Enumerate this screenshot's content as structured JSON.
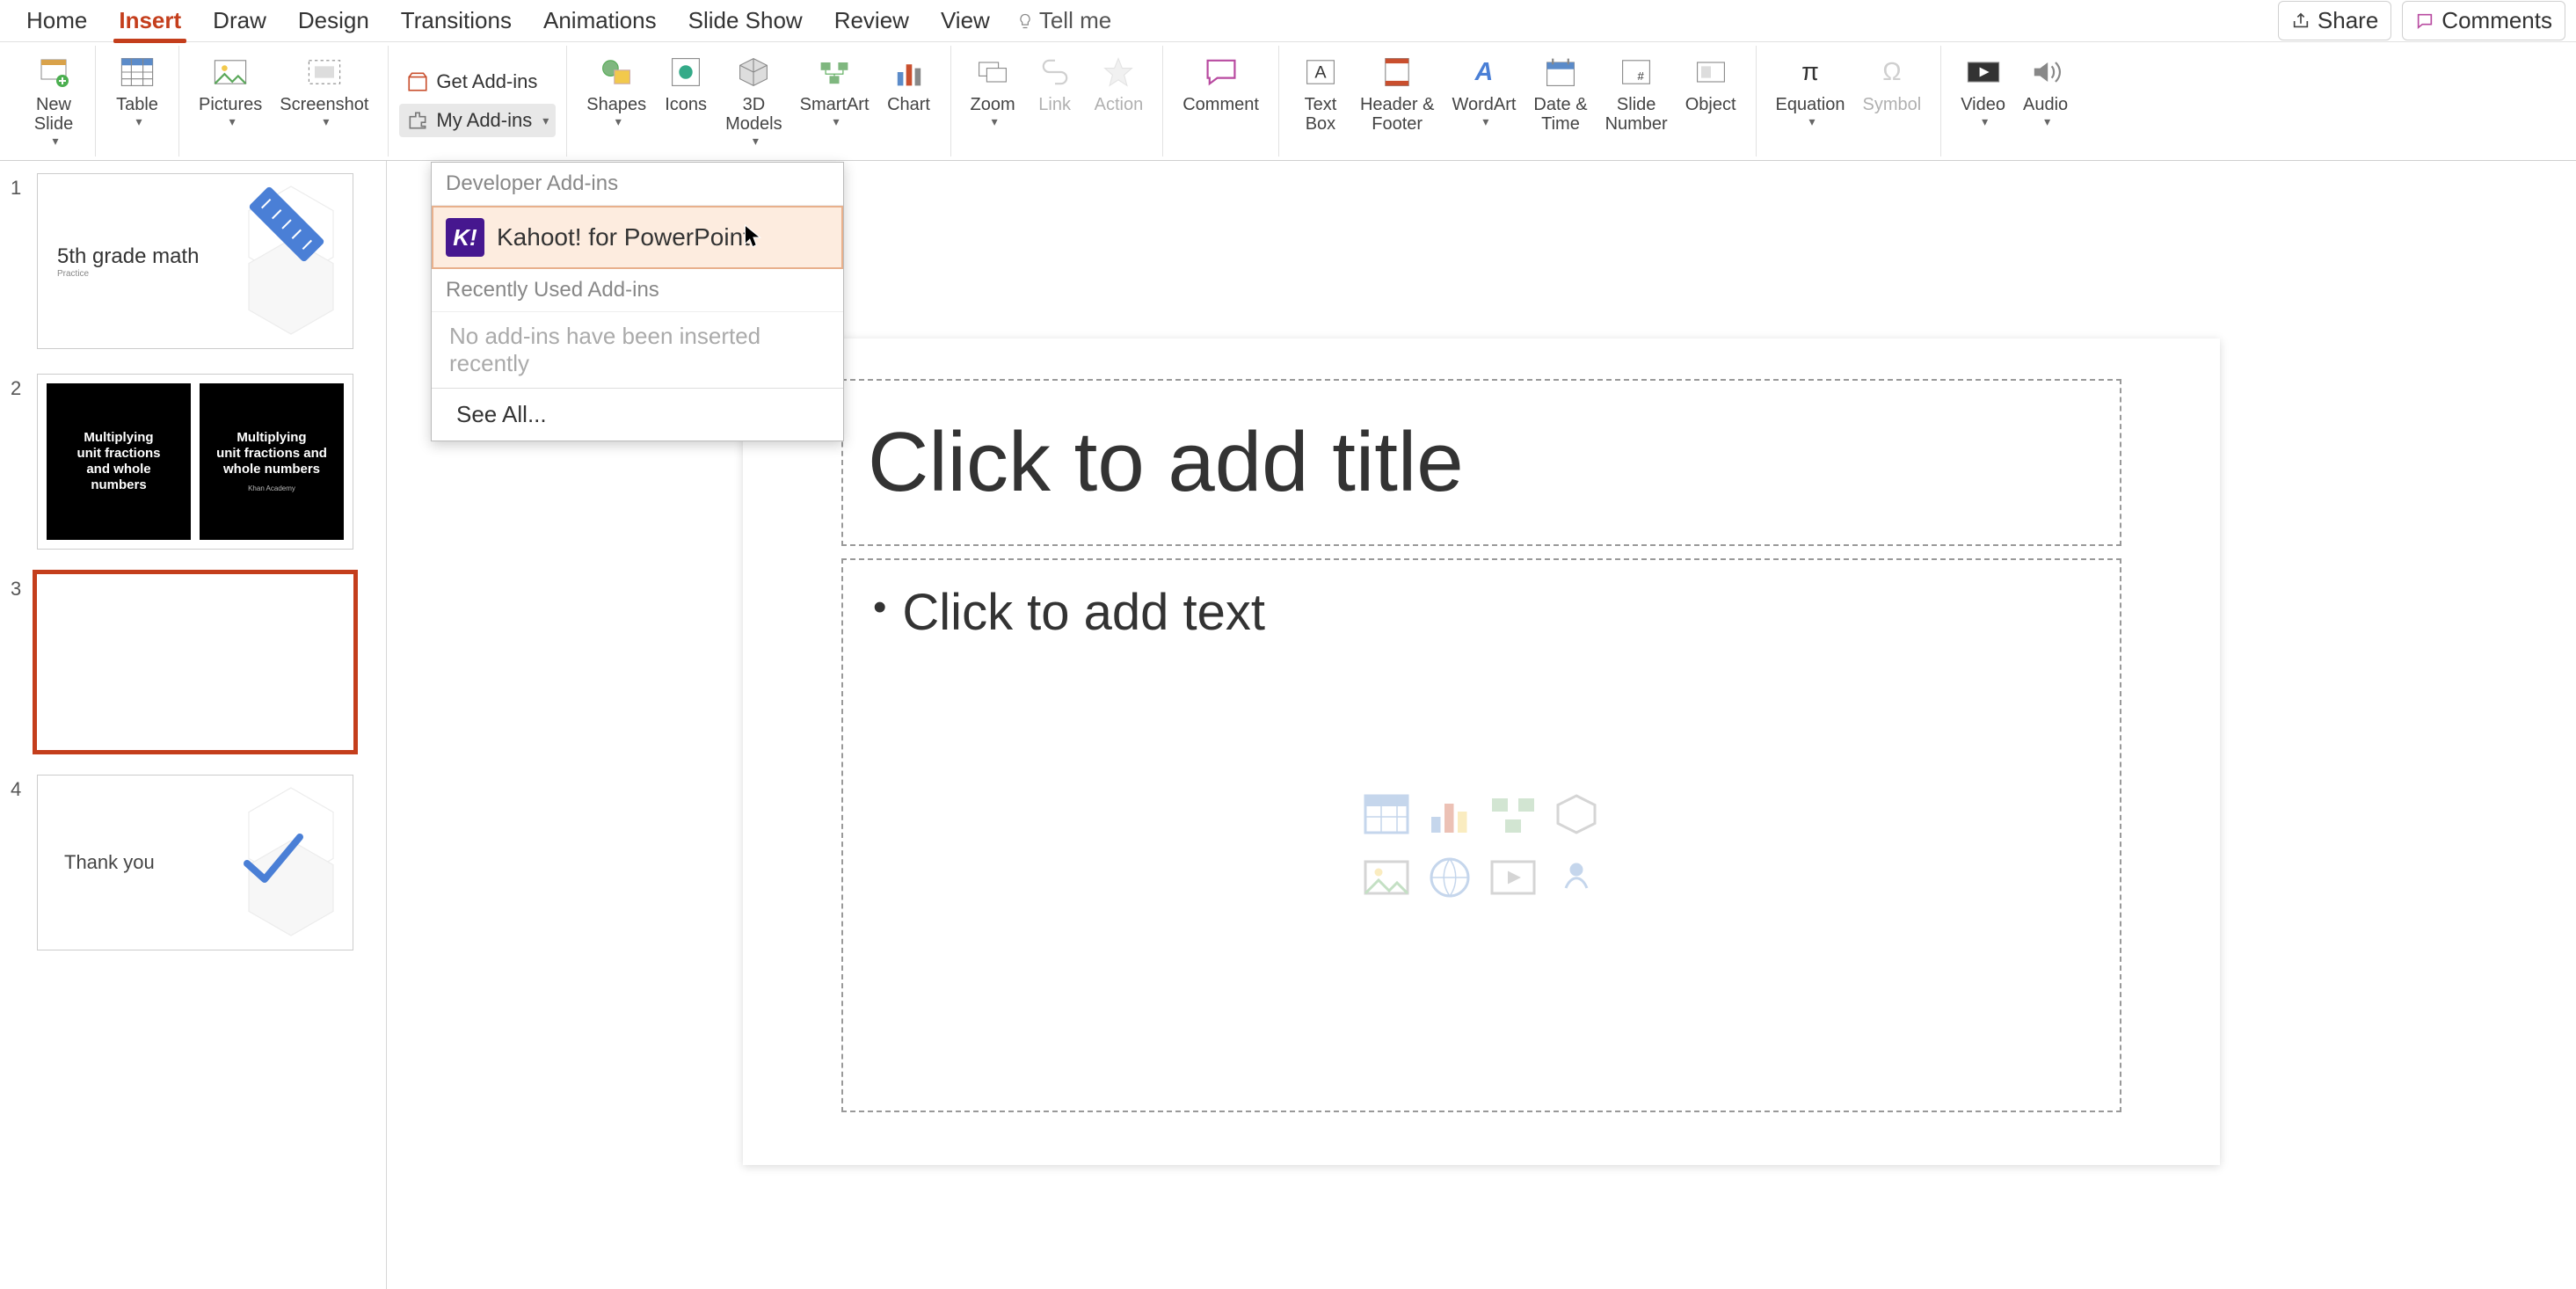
{
  "menubar": {
    "tabs": [
      "Home",
      "Insert",
      "Draw",
      "Design",
      "Transitions",
      "Animations",
      "Slide Show",
      "Review",
      "View"
    ],
    "active_index": 1,
    "tell_me": "Tell me",
    "share": "Share",
    "comments": "Comments"
  },
  "ribbon": {
    "new_slide": "New\nSlide",
    "table": "Table",
    "pictures": "Pictures",
    "screenshot": "Screenshot",
    "get_addins": "Get Add-ins",
    "my_addins": "My Add-ins",
    "shapes": "Shapes",
    "icons": "Icons",
    "models3d": "3D\nModels",
    "smartart": "SmartArt",
    "chart": "Chart",
    "zoom": "Zoom",
    "link": "Link",
    "action": "Action",
    "comment": "Comment",
    "text_box": "Text\nBox",
    "header_footer": "Header &\nFooter",
    "wordart": "WordArt",
    "date_time": "Date &\nTime",
    "slide_number": "Slide\nNumber",
    "object": "Object",
    "equation": "Equation",
    "symbol": "Symbol",
    "video": "Video",
    "audio": "Audio"
  },
  "dropdown": {
    "dev_header": "Developer Add-ins",
    "kahoot": "Kahoot! for PowerPoint",
    "recent_header": "Recently Used Add-ins",
    "recent_empty": "No add-ins have been inserted recently",
    "see_all": "See All..."
  },
  "thumbs": {
    "n1": "1",
    "n2": "2",
    "n3": "3",
    "n4": "4",
    "s1_title": "5th grade math",
    "s1_sub": "Practice",
    "s2_left": "Multiplying\nunit fractions\nand whole\nnumbers",
    "s2_right": "Multiplying\nunit fractions and\nwhole numbers",
    "s2_ka": "Khan Academy",
    "s4_text": "Thank you"
  },
  "canvas": {
    "title_ph": "Click to add title",
    "body_ph": "Click to add text"
  }
}
